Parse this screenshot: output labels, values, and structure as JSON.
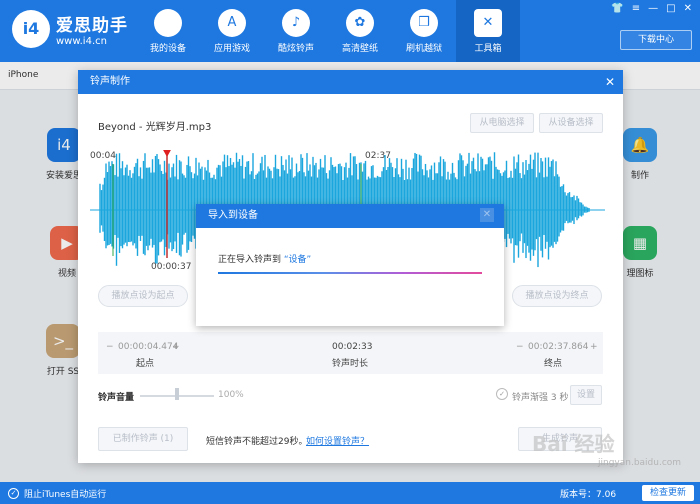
{
  "app": {
    "brand_name": "爱思助手",
    "brand_url": "www.i4.cn",
    "logo_text": "i4"
  },
  "nav": {
    "items": [
      {
        "label": "我的设备",
        "icon": "apple-icon",
        "glyph": ""
      },
      {
        "label": "应用游戏",
        "icon": "appstore-icon",
        "glyph": "A"
      },
      {
        "label": "酷炫铃声",
        "icon": "bell-icon",
        "glyph": "♪"
      },
      {
        "label": "高清壁纸",
        "icon": "flower-icon",
        "glyph": "✿"
      },
      {
        "label": "刷机越狱",
        "icon": "box-icon",
        "glyph": "❒"
      },
      {
        "label": "工具箱",
        "icon": "tools-icon",
        "glyph": "✕"
      }
    ],
    "active_index": 5,
    "download_center": "下载中心"
  },
  "window_controls": [
    "👕",
    "≡",
    "—",
    "□",
    "✕"
  ],
  "device_tab": "iPhone",
  "background_tools": {
    "install": "安装爱思",
    "video": "视频",
    "open_ssh": "打开 SS",
    "right_top": "制作",
    "right_mid": "理图标"
  },
  "ringtone_dialog": {
    "title": "铃声制作",
    "song": "Beyond - 光辉岁月.mp3",
    "btn_from_pc": "从电脑选择",
    "btn_from_device": "从设备选择",
    "time_start_marker": "00:04",
    "time_end_marker": "02:37",
    "time_playhead": "00:00:37",
    "btn_set_start": "播放点设为起点",
    "btn_set_end": "播放点设为终点",
    "start_time": "00:00:04.474",
    "start_label": "起点",
    "duration_time": "00:02:33",
    "duration_label": "铃声时长",
    "end_time": "00:02:37.864",
    "end_label": "终点",
    "volume_label": "铃声音量",
    "volume_value": "100%",
    "volume_level": 0.5,
    "fade_label": "铃声渐强 3 秒",
    "btn_settings": "设置",
    "btn_made": "已制作铃声 (1)",
    "sms_note": "短信铃声不能超过29秒。",
    "how_to_link": "如何设置铃声？",
    "btn_generate": "生成铃声"
  },
  "import_dialog": {
    "title": "导入到设备",
    "msg_prefix": "正在导入铃声到",
    "msg_target": "“设备”",
    "progress": 1.0
  },
  "statusbar": {
    "itunes": "阻止iTunes自动运行",
    "version": "版本号：7.06",
    "update": "检查更新"
  },
  "watermark": {
    "text": "Bai 经验",
    "url": "jingyan.baidu.com"
  },
  "colors": {
    "brand_blue": "#1e78e0",
    "waveform": "#1ba6dd",
    "playhead": "#e02020",
    "marker": "#2fa84a"
  }
}
